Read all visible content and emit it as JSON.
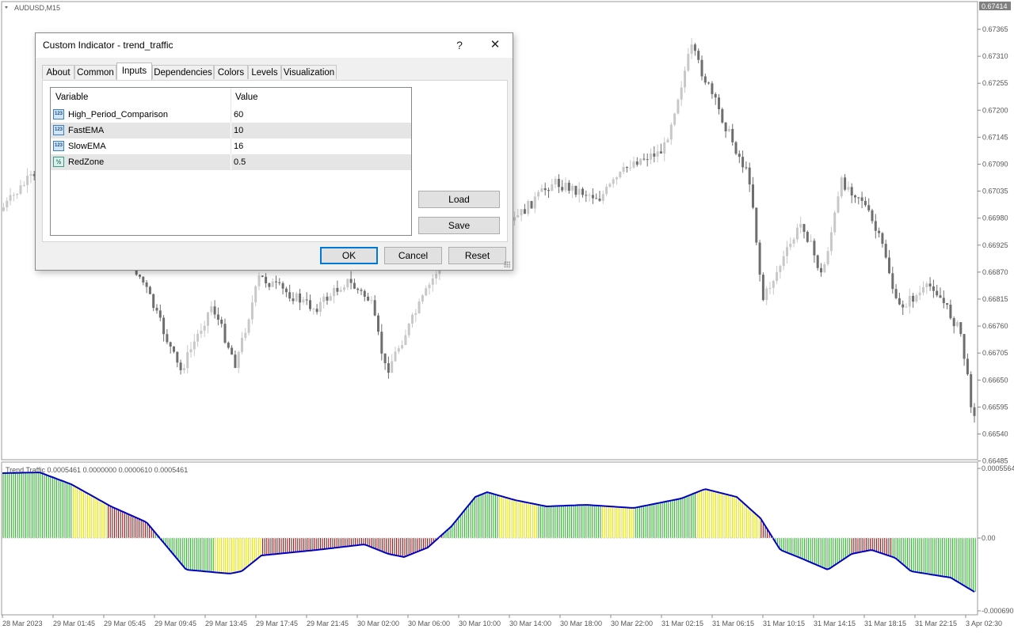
{
  "chart": {
    "symbol_label": "AUDUSD,M15",
    "current_price": "0.67414",
    "price_ticks": [
      "0.67365",
      "0.67310",
      "0.67255",
      "0.67200",
      "0.67145",
      "0.67090",
      "0.67035",
      "0.66980",
      "0.66925",
      "0.66870",
      "0.66815",
      "0.66760",
      "0.66705",
      "0.66650",
      "0.66595",
      "0.66540",
      "0.66485"
    ],
    "time_ticks": [
      "28 Mar 2023",
      "29 Mar 01:45",
      "29 Mar 05:45",
      "29 Mar 09:45",
      "29 Mar 13:45",
      "29 Mar 17:45",
      "29 Mar 21:45",
      "30 Mar 02:00",
      "30 Mar 06:00",
      "30 Mar 10:00",
      "30 Mar 14:00",
      "30 Mar 18:00",
      "30 Mar 22:00",
      "31 Mar 02:15",
      "31 Mar 06:15",
      "31 Mar 10:15",
      "31 Mar 14:15",
      "31 Mar 18:15",
      "31 Mar 22:15",
      "3 Apr 02:30"
    ],
    "indicator_label": "Trend Traffic 0.0005461 0.0000000 0.0000610 0.0005461",
    "indicator_ticks": [
      "0.0005564",
      "0.00",
      "-0.000690"
    ],
    "colors": {
      "bull_candle": "#c8c8c8",
      "bear_candle": "#6e6e6e",
      "hist_green": "#2fb52f",
      "hist_yellow": "#e6e600",
      "hist_red": "#8b1a1a",
      "line": "#0000c8",
      "price_badge": "#808080"
    }
  },
  "dialog": {
    "title": "Custom Indicator - trend_traffic",
    "help_label": "?",
    "close_label": "✕",
    "tabs": [
      {
        "label": "About"
      },
      {
        "label": "Common"
      },
      {
        "label": "Inputs",
        "active": true
      },
      {
        "label": "Dependencies"
      },
      {
        "label": "Colors"
      },
      {
        "label": "Levels"
      },
      {
        "label": "Visualization"
      }
    ],
    "table": {
      "headers": {
        "variable": "Variable",
        "value": "Value"
      },
      "rows": [
        {
          "icon": "123",
          "name": "High_Period_Comparison",
          "value": "60"
        },
        {
          "icon": "123",
          "name": "FastEMA",
          "value": "10"
        },
        {
          "icon": "123",
          "name": "SlowEMA",
          "value": "16"
        },
        {
          "icon": "½",
          "name": "RedZone",
          "value": "0.5"
        }
      ]
    },
    "buttons": {
      "load": "Load",
      "save": "Save",
      "ok": "OK",
      "cancel": "Cancel",
      "reset": "Reset"
    }
  }
}
